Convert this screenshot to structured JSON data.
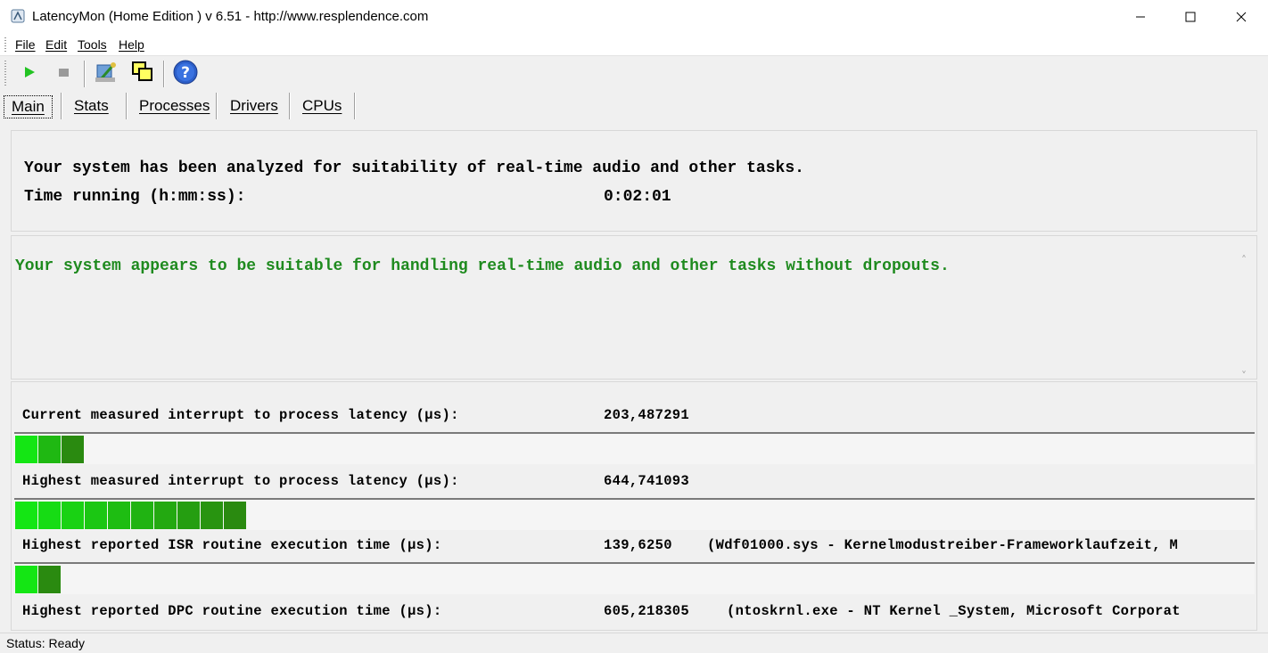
{
  "window": {
    "title": "LatencyMon  (Home Edition )  v 6.51 - http://www.resplendence.com"
  },
  "menu": [
    "File",
    "Edit",
    "Tools",
    "Help"
  ],
  "toolbar": {
    "icons": [
      "play-icon",
      "stop-icon",
      "submit-icon",
      "windows-icon",
      "help-icon"
    ]
  },
  "tabs": [
    "Main",
    "Stats",
    "Processes",
    "Drivers",
    "CPUs"
  ],
  "summary": {
    "line1": "Your system has been analyzed for suitability of real-time audio and other tasks.",
    "time_label": "Time running (h:mm:ss):",
    "time_value": "0:02:01"
  },
  "verdict": {
    "text": "Your system appears to be suitable for handling real-time audio and other tasks without dropouts.",
    "color": "#1e8a1e"
  },
  "metrics": [
    {
      "label": "Current measured interrupt to process latency (µs):",
      "value": "203,487291",
      "detail": "",
      "bar_segments": 3
    },
    {
      "label": "Highest measured interrupt to process latency (µs):",
      "value": "644,741093",
      "detail": "",
      "bar_segments": 10
    },
    {
      "label": "Highest reported ISR routine execution time (µs):",
      "value": "139,6250",
      "detail": "(Wdf01000.sys - Kernelmodustreiber-Frameworklaufzeit, M",
      "bar_segments": 2
    },
    {
      "label": "Highest reported DPC routine execution time (µs):",
      "value": "605,218305",
      "detail": "(ntoskrnl.exe - NT Kernel _System, Microsoft Corporat",
      "bar_segments": null
    }
  ],
  "status": {
    "text": "Status: Ready"
  }
}
